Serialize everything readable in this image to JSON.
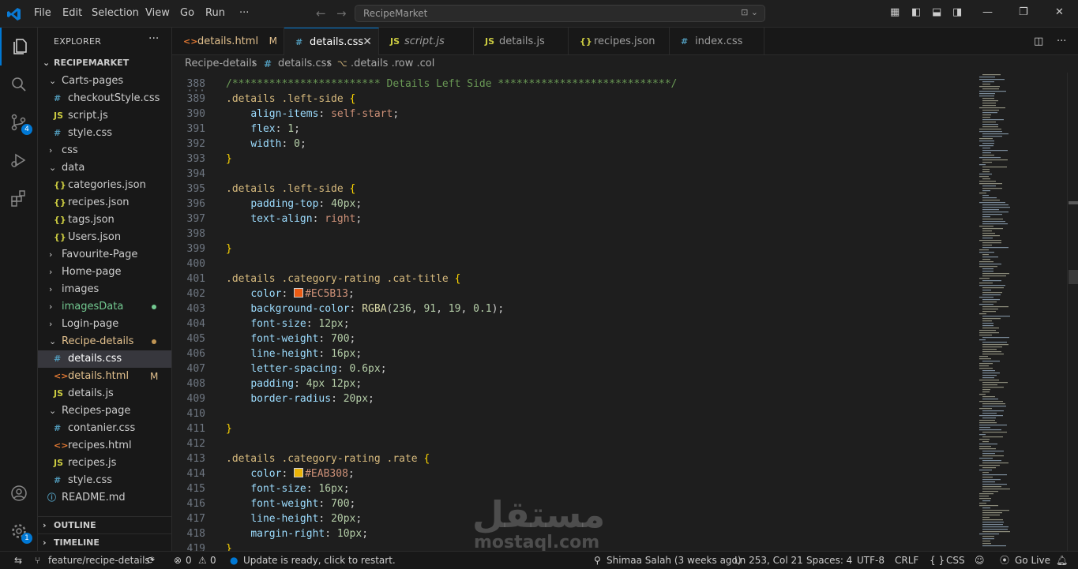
{
  "menu": [
    "File",
    "Edit",
    "Selection",
    "View",
    "Go",
    "Run",
    "···"
  ],
  "command_center": {
    "text": "RecipeMarket"
  },
  "activity": {
    "scm_badge": "4",
    "accounts_badge": "1"
  },
  "explorer": {
    "title": "EXPLORER",
    "root": "RECIPEMARKET",
    "items": [
      {
        "label": "Carts-pages",
        "kind": "folder-open",
        "depth": 1,
        "color": "#cccccc"
      },
      {
        "label": "checkoutStyle.css",
        "kind": "css",
        "depth": 2,
        "color": "#cccccc"
      },
      {
        "label": "script.js",
        "kind": "js",
        "depth": 2,
        "color": "#cccccc"
      },
      {
        "label": "style.css",
        "kind": "css",
        "depth": 2,
        "color": "#cccccc"
      },
      {
        "label": "css",
        "kind": "folder",
        "depth": 1,
        "color": "#cccccc"
      },
      {
        "label": "data",
        "kind": "folder-open",
        "depth": 1,
        "color": "#cccccc"
      },
      {
        "label": "categories.json",
        "kind": "json",
        "depth": 2,
        "color": "#cccccc"
      },
      {
        "label": "recipes.json",
        "kind": "json",
        "depth": 2,
        "color": "#cccccc"
      },
      {
        "label": "tags.json",
        "kind": "json",
        "depth": 2,
        "color": "#cccccc"
      },
      {
        "label": "Users.json",
        "kind": "json",
        "depth": 2,
        "color": "#cccccc"
      },
      {
        "label": "Favourite-Page",
        "kind": "folder",
        "depth": 1,
        "color": "#cccccc"
      },
      {
        "label": "Home-page",
        "kind": "folder",
        "depth": 1,
        "color": "#cccccc"
      },
      {
        "label": "images",
        "kind": "folder",
        "depth": 1,
        "color": "#cccccc"
      },
      {
        "label": "imagesData",
        "kind": "folder",
        "depth": 1,
        "color": "#73c991",
        "dot": "#73c991"
      },
      {
        "label": "Login-page",
        "kind": "folder",
        "depth": 1,
        "color": "#cccccc"
      },
      {
        "label": "Recipe-details",
        "kind": "folder-open",
        "depth": 1,
        "color": "#e2c08d",
        "dot": "#c09553"
      },
      {
        "label": "details.css",
        "kind": "css",
        "depth": 2,
        "color": "#ffffff",
        "selected": true
      },
      {
        "label": "details.html",
        "kind": "html",
        "depth": 2,
        "color": "#e2c08d",
        "status": "M"
      },
      {
        "label": "details.js",
        "kind": "js",
        "depth": 2,
        "color": "#cccccc"
      },
      {
        "label": "Recipes-page",
        "kind": "folder-open",
        "depth": 1,
        "color": "#cccccc"
      },
      {
        "label": "contanier.css",
        "kind": "css",
        "depth": 2,
        "color": "#cccccc"
      },
      {
        "label": "recipes.html",
        "kind": "html",
        "depth": 2,
        "color": "#cccccc"
      },
      {
        "label": "recipes.js",
        "kind": "js",
        "depth": 2,
        "color": "#cccccc"
      },
      {
        "label": "style.css",
        "kind": "css",
        "depth": 2,
        "color": "#cccccc"
      },
      {
        "label": "README.md",
        "kind": "md",
        "depth": 1,
        "color": "#cccccc"
      }
    ],
    "outline": "OUTLINE",
    "timeline": "TIMELINE"
  },
  "tabs": [
    {
      "label": "details.html",
      "kind": "html",
      "modified": "M",
      "active": false,
      "italic": false
    },
    {
      "label": "details.css",
      "kind": "css",
      "active": true,
      "italic": false
    },
    {
      "label": "script.js",
      "kind": "js",
      "active": false,
      "italic": true
    },
    {
      "label": "details.js",
      "kind": "js",
      "active": false,
      "italic": false
    },
    {
      "label": "recipes.json",
      "kind": "json",
      "active": false,
      "italic": false
    },
    {
      "label": "index.css",
      "kind": "css",
      "active": false,
      "italic": false
    }
  ],
  "breadcrumb": {
    "folder": "Recipe-details",
    "file": "details.css",
    "symbol": ".details .row .col"
  },
  "code": [
    {
      "n": "388",
      "tokens": [
        [
          "c-comment",
          "/************************ Details Left Side ****************************/"
        ]
      ]
    },
    {
      "n": "389",
      "tokens": [
        [
          "c-sel",
          ".details .left-side "
        ],
        [
          "c-brace",
          "{"
        ]
      ]
    },
    {
      "n": "390",
      "tokens": [
        [
          "c-punct",
          "    "
        ],
        [
          "c-prop",
          "align-items"
        ],
        [
          "c-punct",
          ": "
        ],
        [
          "c-val",
          "self-start"
        ],
        [
          "c-punct",
          ";"
        ]
      ]
    },
    {
      "n": "391",
      "tokens": [
        [
          "c-punct",
          "    "
        ],
        [
          "c-prop",
          "flex"
        ],
        [
          "c-punct",
          ": "
        ],
        [
          "c-num",
          "1"
        ],
        [
          "c-punct",
          ";"
        ]
      ]
    },
    {
      "n": "392",
      "tokens": [
        [
          "c-punct",
          "    "
        ],
        [
          "c-prop",
          "width"
        ],
        [
          "c-punct",
          ": "
        ],
        [
          "c-num",
          "0"
        ],
        [
          "c-punct",
          ";"
        ]
      ]
    },
    {
      "n": "393",
      "tokens": [
        [
          "c-brace",
          "}"
        ]
      ]
    },
    {
      "n": "394",
      "tokens": []
    },
    {
      "n": "395",
      "tokens": [
        [
          "c-sel",
          ".details .left-side "
        ],
        [
          "c-brace",
          "{"
        ]
      ]
    },
    {
      "n": "396",
      "tokens": [
        [
          "c-punct",
          "    "
        ],
        [
          "c-prop",
          "padding-top"
        ],
        [
          "c-punct",
          ": "
        ],
        [
          "c-num",
          "40px"
        ],
        [
          "c-punct",
          ";"
        ]
      ]
    },
    {
      "n": "397",
      "tokens": [
        [
          "c-punct",
          "    "
        ],
        [
          "c-prop",
          "text-align"
        ],
        [
          "c-punct",
          ": "
        ],
        [
          "c-val",
          "right"
        ],
        [
          "c-punct",
          ";"
        ]
      ]
    },
    {
      "n": "398",
      "tokens": []
    },
    {
      "n": "399",
      "tokens": [
        [
          "c-brace",
          "}"
        ]
      ]
    },
    {
      "n": "400",
      "tokens": []
    },
    {
      "n": "401",
      "tokens": [
        [
          "c-sel",
          ".details .category-rating .cat-title "
        ],
        [
          "c-brace",
          "{"
        ]
      ]
    },
    {
      "n": "402",
      "tokens": [
        [
          "c-punct",
          "    "
        ],
        [
          "c-prop",
          "color"
        ],
        [
          "c-punct",
          ": "
        ],
        [
          "swatch",
          "#EC5B13"
        ],
        [
          "c-val",
          "#EC5B13"
        ],
        [
          "c-punct",
          ";"
        ]
      ]
    },
    {
      "n": "403",
      "tokens": [
        [
          "c-punct",
          "    "
        ],
        [
          "c-prop",
          "background-color"
        ],
        [
          "c-punct",
          ": "
        ],
        [
          "c-fn",
          "RGBA"
        ],
        [
          "c-punct",
          "("
        ],
        [
          "c-num",
          "236"
        ],
        [
          "c-punct",
          ", "
        ],
        [
          "c-num",
          "91"
        ],
        [
          "c-punct",
          ", "
        ],
        [
          "c-num",
          "19"
        ],
        [
          "c-punct",
          ", "
        ],
        [
          "c-num",
          "0.1"
        ],
        [
          "c-punct",
          ");"
        ]
      ]
    },
    {
      "n": "404",
      "tokens": [
        [
          "c-punct",
          "    "
        ],
        [
          "c-prop",
          "font-size"
        ],
        [
          "c-punct",
          ": "
        ],
        [
          "c-num",
          "12px"
        ],
        [
          "c-punct",
          ";"
        ]
      ]
    },
    {
      "n": "405",
      "tokens": [
        [
          "c-punct",
          "    "
        ],
        [
          "c-prop",
          "font-weight"
        ],
        [
          "c-punct",
          ": "
        ],
        [
          "c-num",
          "700"
        ],
        [
          "c-punct",
          ";"
        ]
      ]
    },
    {
      "n": "406",
      "tokens": [
        [
          "c-punct",
          "    "
        ],
        [
          "c-prop",
          "line-height"
        ],
        [
          "c-punct",
          ": "
        ],
        [
          "c-num",
          "16px"
        ],
        [
          "c-punct",
          ";"
        ]
      ]
    },
    {
      "n": "407",
      "tokens": [
        [
          "c-punct",
          "    "
        ],
        [
          "c-prop",
          "letter-spacing"
        ],
        [
          "c-punct",
          ": "
        ],
        [
          "c-num",
          "0.6px"
        ],
        [
          "c-punct",
          ";"
        ]
      ]
    },
    {
      "n": "408",
      "tokens": [
        [
          "c-punct",
          "    "
        ],
        [
          "c-prop",
          "padding"
        ],
        [
          "c-punct",
          ": "
        ],
        [
          "c-num",
          "4px 12px"
        ],
        [
          "c-punct",
          ";"
        ]
      ]
    },
    {
      "n": "409",
      "tokens": [
        [
          "c-punct",
          "    "
        ],
        [
          "c-prop",
          "border-radius"
        ],
        [
          "c-punct",
          ": "
        ],
        [
          "c-num",
          "20px"
        ],
        [
          "c-punct",
          ";"
        ]
      ]
    },
    {
      "n": "410",
      "tokens": []
    },
    {
      "n": "411",
      "tokens": [
        [
          "c-brace",
          "}"
        ]
      ]
    },
    {
      "n": "412",
      "tokens": []
    },
    {
      "n": "413",
      "tokens": [
        [
          "c-sel",
          ".details .category-rating .rate "
        ],
        [
          "c-brace",
          "{"
        ]
      ]
    },
    {
      "n": "414",
      "tokens": [
        [
          "c-punct",
          "    "
        ],
        [
          "c-prop",
          "color"
        ],
        [
          "c-punct",
          ": "
        ],
        [
          "swatch",
          "#EAB308"
        ],
        [
          "c-val",
          "#EAB308"
        ],
        [
          "c-punct",
          ";"
        ]
      ]
    },
    {
      "n": "415",
      "tokens": [
        [
          "c-punct",
          "    "
        ],
        [
          "c-prop",
          "font-size"
        ],
        [
          "c-punct",
          ": "
        ],
        [
          "c-num",
          "16px"
        ],
        [
          "c-punct",
          ";"
        ]
      ]
    },
    {
      "n": "416",
      "tokens": [
        [
          "c-punct",
          "    "
        ],
        [
          "c-prop",
          "font-weight"
        ],
        [
          "c-punct",
          ": "
        ],
        [
          "c-num",
          "700"
        ],
        [
          "c-punct",
          ";"
        ]
      ]
    },
    {
      "n": "417",
      "tokens": [
        [
          "c-punct",
          "    "
        ],
        [
          "c-prop",
          "line-height"
        ],
        [
          "c-punct",
          ": "
        ],
        [
          "c-num",
          "20px"
        ],
        [
          "c-punct",
          ";"
        ]
      ]
    },
    {
      "n": "418",
      "tokens": [
        [
          "c-punct",
          "    "
        ],
        [
          "c-prop",
          "margin-right"
        ],
        [
          "c-punct",
          ": "
        ],
        [
          "c-num",
          "10px"
        ],
        [
          "c-punct",
          ";"
        ]
      ]
    },
    {
      "n": "419",
      "tokens": [
        [
          "c-brace",
          "}"
        ]
      ]
    }
  ],
  "watermark": {
    "arabic": "مستقل",
    "latin": "mostaql.com"
  },
  "status": {
    "branch": "feature/recipe-details*",
    "errors": "0",
    "warnings": "0",
    "update": "Update is ready, click to restart.",
    "blame": "Shimaa Salah (3 weeks ago)",
    "position": "Ln 253, Col 21",
    "spaces": "Spaces: 4",
    "encoding": "UTF-8",
    "eol": "CRLF",
    "language": "CSS",
    "golive": "Go Live"
  },
  "colors": {
    "accent": "#0078d4",
    "html_icon": "#e37933",
    "css_icon": "#519aba",
    "js_icon": "#cbcb41",
    "json_icon": "#cbcb41",
    "md_icon": "#519aba"
  }
}
